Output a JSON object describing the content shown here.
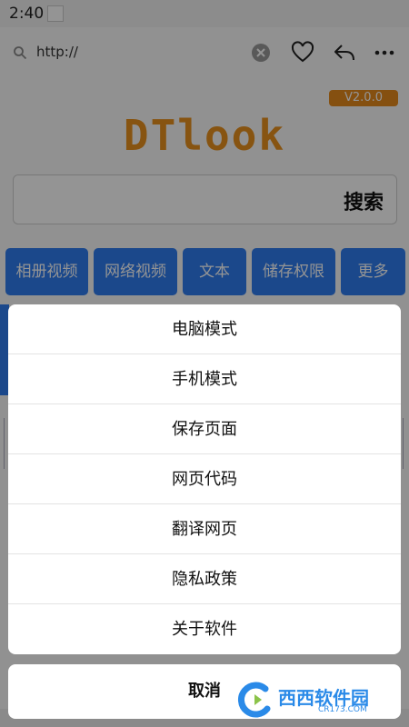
{
  "status_bar": {
    "time": "2:40"
  },
  "address_bar": {
    "url": "http://"
  },
  "app": {
    "version": "V2.0.0",
    "logo": "DTlook",
    "search_label": "搜索"
  },
  "chips": [
    "相册视频",
    "网络视频",
    "文本",
    "储存权限",
    "更多"
  ],
  "menu": {
    "items": [
      "电脑模式",
      "手机模式",
      "保存页面",
      "网页代码",
      "翻译网页",
      "隐私政策",
      "关于软件"
    ],
    "cancel": "取消"
  },
  "watermark": {
    "name": "西西软件园",
    "url": "CR173.COM"
  },
  "colors": {
    "accent": "#2f7df0",
    "brand": "#e8911e",
    "badge": "#e58a1c"
  }
}
